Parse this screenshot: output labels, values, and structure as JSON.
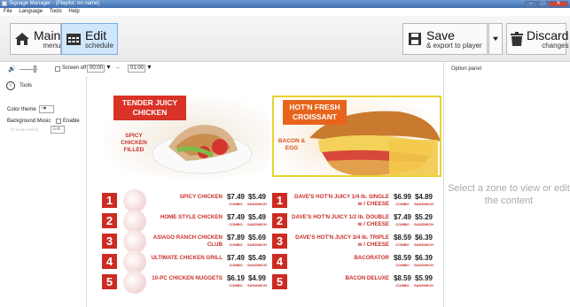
{
  "window": {
    "title": "Signage Manager - (Playlist: no name)"
  },
  "menu": [
    "File",
    "Language",
    "Tools",
    "Help"
  ],
  "toolbar": {
    "main": {
      "big": "Main",
      "small": "menu"
    },
    "edit": {
      "big": "Edit",
      "small": "schedule"
    },
    "save": {
      "big": "Save",
      "small": "& export to player"
    },
    "discard": {
      "big": "Discard",
      "small": "changes"
    }
  },
  "controls": {
    "screen_off": "Screen off",
    "time_from": "00:00",
    "time_to": "01:00"
  },
  "sidebar": {
    "tools": "Tools",
    "color_theme": "Color theme",
    "bg_music": "Background Music",
    "enable": "Enable",
    "mode": "(F mode on/list)",
    "edit": "Edit"
  },
  "option_panel": {
    "title": "Option panel",
    "message": "Select a zone to view or edit the content"
  },
  "menu_board": {
    "hero_left": {
      "banner": "TENDER JUICY CHICKEN",
      "text": "SPICY CHICKEN FILLED"
    },
    "hero_right": {
      "banner": "HOT'N FRESH CROISSANT",
      "text": "BACON & EGG"
    },
    "combo_label": "COMBO",
    "sandwich_label": "SANDWICH",
    "left_items": [
      {
        "num": "1",
        "name": "SPICY CHICKEN",
        "combo": "$7.49",
        "sandwich": "$5.49"
      },
      {
        "num": "2",
        "name": "HOME STYLE CHICKEN",
        "combo": "$7.49",
        "sandwich": "$5.49"
      },
      {
        "num": "3",
        "name": "ASIAGO RANCH CHICKEN CLUB",
        "combo": "$7.89",
        "sandwich": "$5.69"
      },
      {
        "num": "4",
        "name": "ULTIMATE CHICKEN GRILL",
        "combo": "$7.49",
        "sandwich": "$5.49"
      },
      {
        "num": "5",
        "name": "10-PC CHICKEN NUGGETS",
        "combo": "$6.19",
        "sandwich": "$4.99"
      }
    ],
    "right_items": [
      {
        "num": "1",
        "name": "DAVE'S HOT'N JUICY 1/4 lb. SINGLE w / CHEESE",
        "combo": "$6.99",
        "sandwich": "$4.89"
      },
      {
        "num": "2",
        "name": "DAVE'S HOT'N JUICY 1/2 lb. DOUBLE w / CHEESE",
        "combo": "$7.49",
        "sandwich": "$5.29"
      },
      {
        "num": "3",
        "name": "DAVE'S HOT'N JUICY 3/4 lb. TRIPLE w / CHEESE",
        "combo": "$8.59",
        "sandwich": "$6.39"
      },
      {
        "num": "4",
        "name": "BACORATOR",
        "combo": "$8.59",
        "sandwich": "$6.39"
      },
      {
        "num": "5",
        "name": "BACON DELUXE",
        "combo": "$8.59",
        "sandwich": "$5.99"
      }
    ]
  },
  "colors": {
    "accent_red": "#cc2b23",
    "highlight": "#e8d331",
    "active_button": "#cfe6fb"
  }
}
